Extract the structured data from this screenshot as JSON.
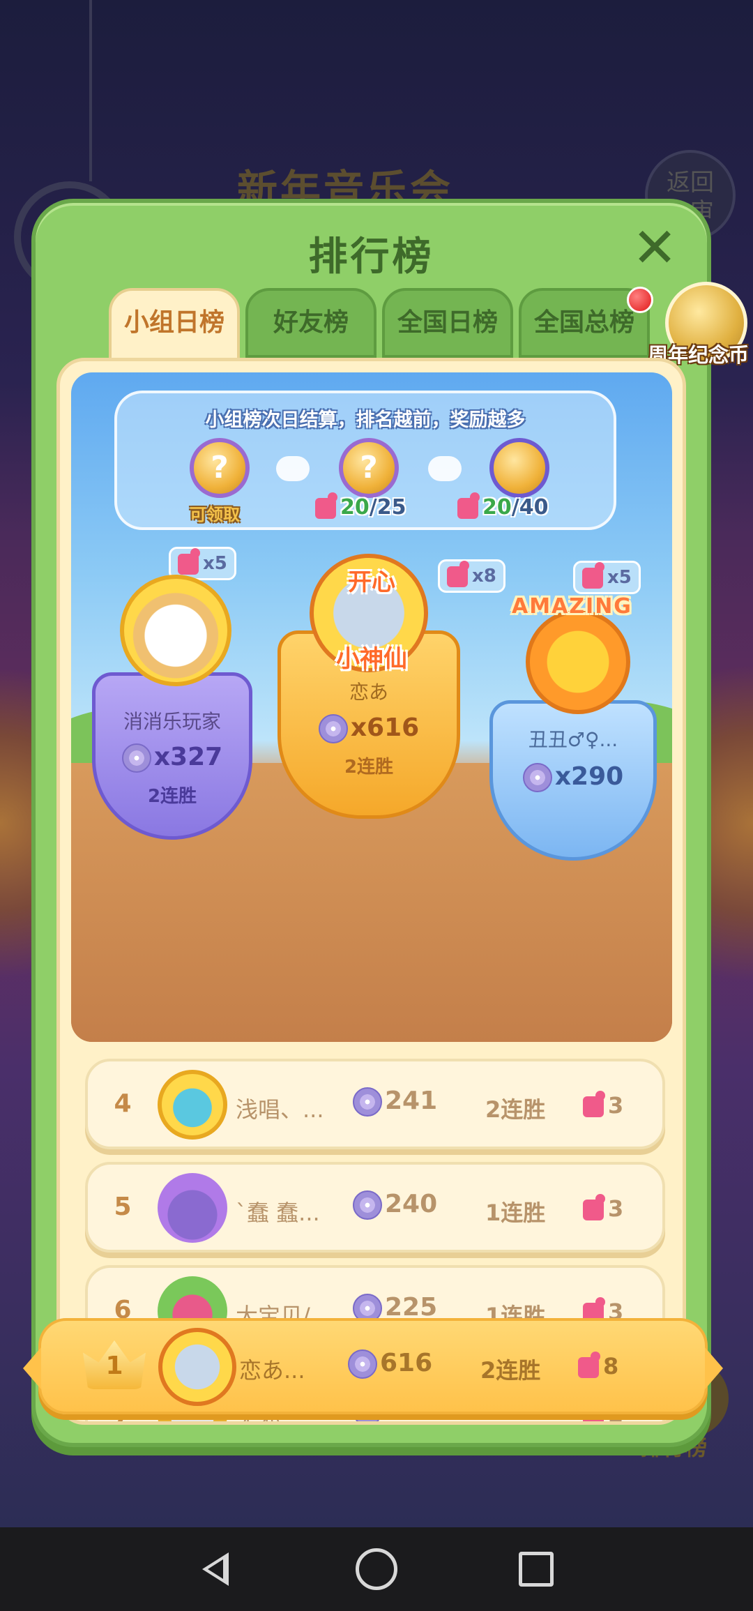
{
  "background": {
    "title": "新年音乐会",
    "back_button": "返回\n主审",
    "bottom_label": "排行榜"
  },
  "modal": {
    "title": "排行榜",
    "close_icon": "close-icon",
    "tabs": [
      {
        "label": "小组日榜",
        "active": true
      },
      {
        "label": "好友榜",
        "active": false
      },
      {
        "label": "全国日榜",
        "active": false
      },
      {
        "label": "全国总榜",
        "active": false
      }
    ],
    "coin_label": "周年纪念币"
  },
  "rewards": {
    "notice": "小组榜次日结算，排名越前，奖励越多",
    "items": [
      {
        "status": "可领取"
      },
      {
        "progress_current": "20",
        "progress_total": "/25"
      },
      {
        "progress_current": "20",
        "progress_total": "/40"
      }
    ],
    "disc_glyph": "?"
  },
  "podium": {
    "second": {
      "bubble": "x5",
      "name": "消消乐玩家",
      "score": "x327",
      "streak": "2连胜"
    },
    "first": {
      "bubble": "x8",
      "crest": "开心\n小神仙",
      "name": "恋あ",
      "score": "x616",
      "streak": "2连胜"
    },
    "third": {
      "bubble": "x5",
      "crest": "AMAZING",
      "name": "丑丑♂♀...",
      "score": "x290",
      "streak": ""
    }
  },
  "rankings": [
    {
      "rank": "4",
      "name": "浅唱、...",
      "score": "241",
      "streak": "2连胜",
      "pieces": "3"
    },
    {
      "rank": "5",
      "name": "ˋ蠢  蠢...",
      "score": "240",
      "streak": "1连胜",
      "pieces": "3"
    },
    {
      "rank": "6",
      "name": "大宝贝/...",
      "score": "225",
      "streak": "1连胜",
      "pieces": "3"
    },
    {
      "rank": "7",
      "name": "无邪",
      "score": "225",
      "streak": "",
      "pieces": "2"
    }
  ],
  "my_row": {
    "rank": "1",
    "name": "恋あ...",
    "score": "616",
    "streak": "2连胜",
    "pieces": "8",
    "crest": "开心\n小神仙"
  },
  "colors": {
    "modal_green": "#8fcf68",
    "panel_cream": "#fff1c8",
    "active_tab_text": "#c0752b",
    "puzzle_pink": "#f05a8a"
  }
}
